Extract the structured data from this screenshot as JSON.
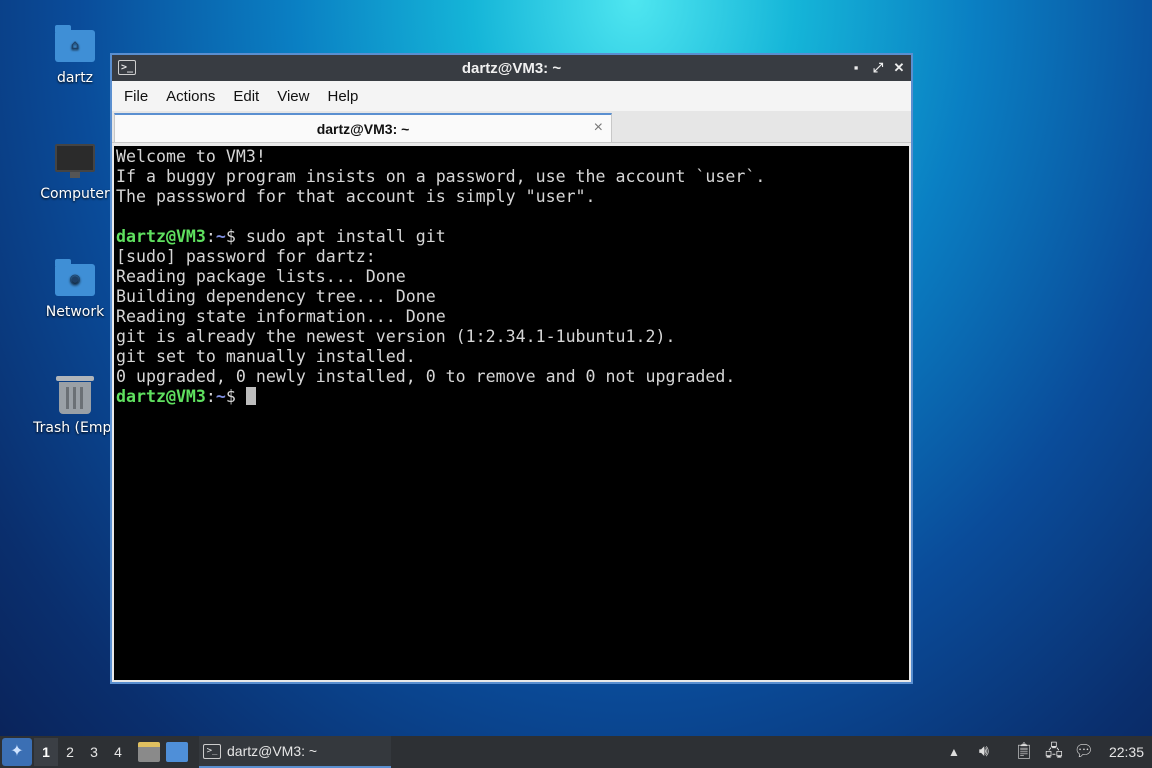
{
  "desktop": {
    "icons": [
      {
        "label": "dartz",
        "icon": "home-folder-icon"
      },
      {
        "label": "Computer",
        "icon": "computer-icon"
      },
      {
        "label": "Network",
        "icon": "network-folder-icon"
      },
      {
        "label": "Trash (Empt",
        "icon": "trash-icon"
      }
    ]
  },
  "window": {
    "title": "dartz@VM3: ~",
    "controls": {
      "minimize": "▪",
      "maximize": "⤢",
      "close": "✕"
    },
    "menu": [
      "File",
      "Actions",
      "Edit",
      "View",
      "Help"
    ],
    "tab": {
      "label": "dartz@VM3: ~",
      "close": "×"
    }
  },
  "terminal": {
    "welcome": [
      "Welcome to VM3!",
      "If a buggy program insists on a password, use the account `user`.",
      "The passsword for that account is simply \"user\"."
    ],
    "prompt": {
      "user": "dartz@VM3",
      "sep": ":",
      "path": "~",
      "symbol": "$ "
    },
    "command": "sudo apt install git",
    "output": [
      "[sudo] password for dartz:",
      "Reading package lists... Done",
      "Building dependency tree... Done",
      "Reading state information... Done",
      "git is already the newest version (1:2.34.1-1ubuntu1.2).",
      "git set to manually installed.",
      "0 upgraded, 0 newly installed, 0 to remove and 0 not upgraded."
    ]
  },
  "taskbar": {
    "start_icon": "start-menu-icon",
    "workspaces": [
      "1",
      "2",
      "3",
      "4"
    ],
    "active_workspace": "1",
    "task_label": "dartz@VM3: ~",
    "clock": "22:35",
    "colors": {
      "accent": "#5a8fd0",
      "prompt_user": "#5fe05f",
      "prompt_path": "#7f8fe0"
    }
  }
}
